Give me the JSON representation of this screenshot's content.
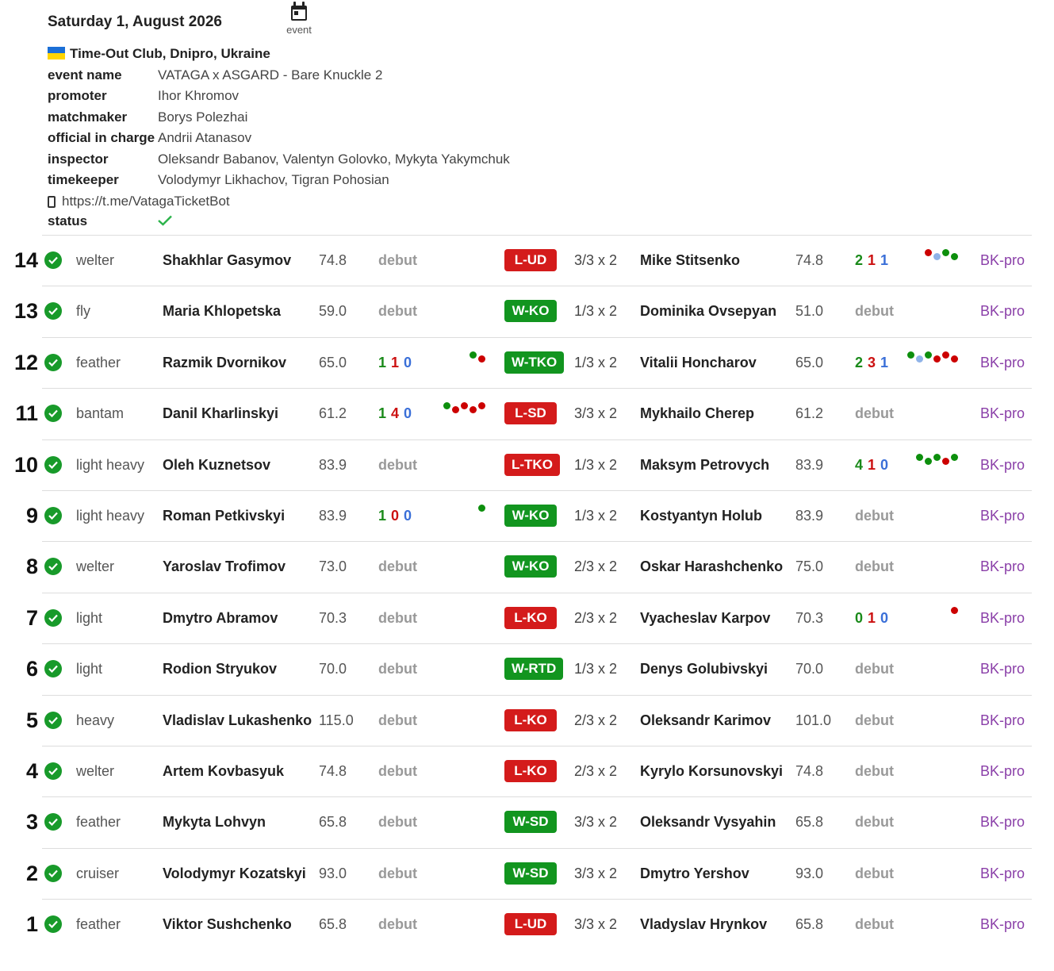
{
  "event": {
    "date": "Saturday 1, August 2026",
    "event_icon_label": "event",
    "venue": "Time-Out Club, Dnipro, Ukraine",
    "fields": [
      {
        "key": "event name",
        "value": "VATAGA x ASGARD - Bare Knuckle 2"
      },
      {
        "key": "promoter",
        "value": "Ihor Khromov"
      },
      {
        "key": "matchmaker",
        "value": "Borys Polezhai"
      },
      {
        "key": "official in charge",
        "value": "Andrii Atanasov"
      },
      {
        "key": "inspector",
        "value": "Oleksandr Babanov, Valentyn Golovko, Mykyta Yakymchuk"
      },
      {
        "key": "timekeeper",
        "value": "Volodymyr Likhachov, Tigran Pohosian"
      }
    ],
    "link": "https://t.me/VatagaTicketBot",
    "status_label": "status"
  },
  "colors": {
    "win": "#12951f",
    "loss": "#d41b1b",
    "link": "#8a3fa8",
    "debut": "#999999"
  },
  "bouts": [
    {
      "no": "14",
      "weight_class": "welter",
      "fighter1": "Shakhlar Gasymov",
      "weight1": "74.8",
      "record1": null,
      "form1": [],
      "result": "L-UD",
      "outcome": "loss",
      "format": "3/3 x 2",
      "fighter2": "Mike Stitsenko",
      "weight2": "74.8",
      "record2": {
        "w": "2",
        "l": "1",
        "d": "1"
      },
      "form2": [
        "L",
        "D",
        "W",
        "W"
      ],
      "sport": "BK-pro"
    },
    {
      "no": "13",
      "weight_class": "fly",
      "fighter1": "Maria Khlopetska",
      "weight1": "59.0",
      "record1": null,
      "form1": [],
      "result": "W-KO",
      "outcome": "win",
      "format": "1/3 x 2",
      "fighter2": "Dominika Ovsepyan",
      "weight2": "51.0",
      "record2": null,
      "form2": [],
      "sport": "BK-pro"
    },
    {
      "no": "12",
      "weight_class": "feather",
      "fighter1": "Razmik Dvornikov",
      "weight1": "65.0",
      "record1": {
        "w": "1",
        "l": "1",
        "d": "0"
      },
      "form1": [
        "W",
        "L"
      ],
      "result": "W-TKO",
      "outcome": "win",
      "format": "1/3 x 2",
      "fighter2": "Vitalii Honcharov",
      "weight2": "65.0",
      "record2": {
        "w": "2",
        "l": "3",
        "d": "1"
      },
      "form2": [
        "W",
        "D",
        "W",
        "L",
        "L",
        "L"
      ],
      "sport": "BK-pro"
    },
    {
      "no": "11",
      "weight_class": "bantam",
      "fighter1": "Danil Kharlinskyi",
      "weight1": "61.2",
      "record1": {
        "w": "1",
        "l": "4",
        "d": "0"
      },
      "form1": [
        "W",
        "L",
        "L",
        "L",
        "L"
      ],
      "result": "L-SD",
      "outcome": "loss",
      "format": "3/3 x 2",
      "fighter2": "Mykhailo Cherep",
      "weight2": "61.2",
      "record2": null,
      "form2": [],
      "sport": "BK-pro"
    },
    {
      "no": "10",
      "weight_class": "light heavy",
      "fighter1": "Oleh Kuznetsov",
      "weight1": "83.9",
      "record1": null,
      "form1": [],
      "result": "L-TKO",
      "outcome": "loss",
      "format": "1/3 x 2",
      "fighter2": "Maksym Petrovych",
      "weight2": "83.9",
      "record2": {
        "w": "4",
        "l": "1",
        "d": "0"
      },
      "form2": [
        "W",
        "W",
        "W",
        "L",
        "W"
      ],
      "sport": "BK-pro"
    },
    {
      "no": "9",
      "weight_class": "light heavy",
      "fighter1": "Roman Petkivskyi",
      "weight1": "83.9",
      "record1": {
        "w": "1",
        "l": "0",
        "d": "0"
      },
      "form1": [
        "W"
      ],
      "result": "W-KO",
      "outcome": "win",
      "format": "1/3 x 2",
      "fighter2": "Kostyantyn Holub",
      "weight2": "83.9",
      "record2": null,
      "form2": [],
      "sport": "BK-pro"
    },
    {
      "no": "8",
      "weight_class": "welter",
      "fighter1": "Yaroslav Trofimov",
      "weight1": "73.0",
      "record1": null,
      "form1": [],
      "result": "W-KO",
      "outcome": "win",
      "format": "2/3 x 2",
      "fighter2": "Oskar Harashchenko",
      "weight2": "75.0",
      "record2": null,
      "form2": [],
      "sport": "BK-pro"
    },
    {
      "no": "7",
      "weight_class": "light",
      "fighter1": "Dmytro Abramov",
      "weight1": "70.3",
      "record1": null,
      "form1": [],
      "result": "L-KO",
      "outcome": "loss",
      "format": "2/3 x 2",
      "fighter2": "Vyacheslav Karpov",
      "weight2": "70.3",
      "record2": {
        "w": "0",
        "l": "1",
        "d": "0"
      },
      "form2": [
        "L"
      ],
      "sport": "BK-pro"
    },
    {
      "no": "6",
      "weight_class": "light",
      "fighter1": "Rodion Stryukov",
      "weight1": "70.0",
      "record1": null,
      "form1": [],
      "result": "W-RTD",
      "outcome": "win",
      "format": "1/3 x 2",
      "fighter2": "Denys Golubivskyi",
      "weight2": "70.0",
      "record2": null,
      "form2": [],
      "sport": "BK-pro"
    },
    {
      "no": "5",
      "weight_class": "heavy",
      "fighter1": "Vladislav Lukashenko",
      "weight1": "115.0",
      "record1": null,
      "form1": [],
      "result": "L-KO",
      "outcome": "loss",
      "format": "2/3 x 2",
      "fighter2": "Oleksandr Karimov",
      "weight2": "101.0",
      "record2": null,
      "form2": [],
      "sport": "BK-pro"
    },
    {
      "no": "4",
      "weight_class": "welter",
      "fighter1": "Artem Kovbasyuk",
      "weight1": "74.8",
      "record1": null,
      "form1": [],
      "result": "L-KO",
      "outcome": "loss",
      "format": "2/3 x 2",
      "fighter2": "Kyrylo Korsunovskyi",
      "weight2": "74.8",
      "record2": null,
      "form2": [],
      "sport": "BK-pro"
    },
    {
      "no": "3",
      "weight_class": "feather",
      "fighter1": "Mykyta Lohvyn",
      "weight1": "65.8",
      "record1": null,
      "form1": [],
      "result": "W-SD",
      "outcome": "win",
      "format": "3/3 x 2",
      "fighter2": "Oleksandr Vysyahin",
      "weight2": "65.8",
      "record2": null,
      "form2": [],
      "sport": "BK-pro"
    },
    {
      "no": "2",
      "weight_class": "cruiser",
      "fighter1": "Volodymyr Kozatskyi",
      "weight1": "93.0",
      "record1": null,
      "form1": [],
      "result": "W-SD",
      "outcome": "win",
      "format": "3/3 x 2",
      "fighter2": "Dmytro Yershov",
      "weight2": "93.0",
      "record2": null,
      "form2": [],
      "sport": "BK-pro"
    },
    {
      "no": "1",
      "weight_class": "feather",
      "fighter1": "Viktor Sushchenko",
      "weight1": "65.8",
      "record1": null,
      "form1": [],
      "result": "L-UD",
      "outcome": "loss",
      "format": "3/3 x 2",
      "fighter2": "Vladyslav Hrynkov",
      "weight2": "65.8",
      "record2": null,
      "form2": [],
      "sport": "BK-pro"
    }
  ],
  "labels": {
    "debut": "debut"
  }
}
